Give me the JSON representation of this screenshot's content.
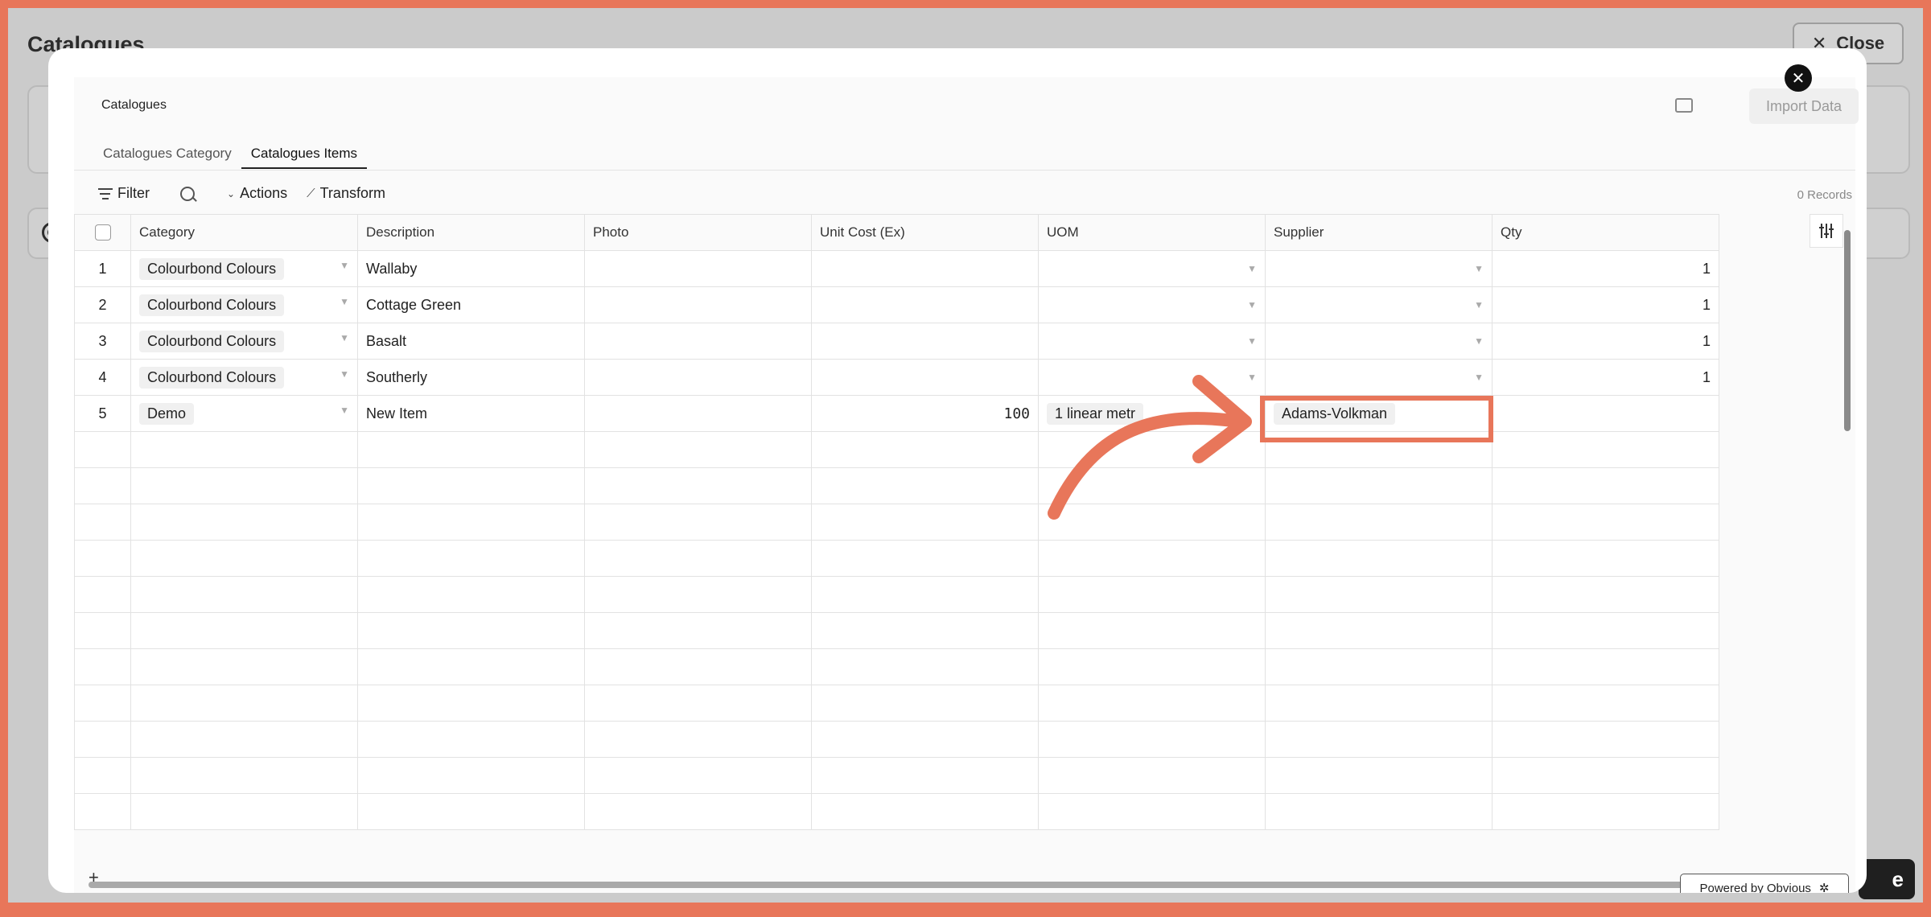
{
  "background": {
    "title": "Catalogues",
    "close_label": "Close",
    "dark_button_partial": "e"
  },
  "modal": {
    "title": "Catalogues",
    "import_label": "Import Data",
    "tabs": [
      "Catalogues Category",
      "Catalogues Items"
    ],
    "active_tab": "Catalogues Items",
    "toolbar": {
      "filter_label": "Filter",
      "actions_label": "Actions",
      "transform_label": "Transform"
    },
    "records_label": "0 Records",
    "columns": [
      "Category",
      "Description",
      "Photo",
      "Unit Cost (Ex)",
      "UOM",
      "Supplier",
      "Qty"
    ],
    "rows": [
      {
        "num": "1",
        "category": "Colourbond Colours",
        "description": "Wallaby",
        "photo": "",
        "unit_cost": "",
        "uom": "",
        "supplier": "",
        "qty": "1"
      },
      {
        "num": "2",
        "category": "Colourbond Colours",
        "description": "Cottage Green",
        "photo": "",
        "unit_cost": "",
        "uom": "",
        "supplier": "",
        "qty": "1"
      },
      {
        "num": "3",
        "category": "Colourbond Colours",
        "description": "Basalt",
        "photo": "",
        "unit_cost": "",
        "uom": "",
        "supplier": "",
        "qty": "1"
      },
      {
        "num": "4",
        "category": "Colourbond Colours",
        "description": "Southerly",
        "photo": "",
        "unit_cost": "",
        "uom": "",
        "supplier": "",
        "qty": "1"
      },
      {
        "num": "5",
        "category": "Demo",
        "description": "New Item",
        "photo": "",
        "unit_cost": "100",
        "uom": "1 linear metr",
        "supplier": "Adams-Volkman",
        "qty": ""
      }
    ],
    "add_row_label": "+",
    "powered_by": "Powered by Obvious"
  },
  "colors": {
    "accent": "#e8765a",
    "backdrop": "#cbcbcb"
  },
  "icons": [
    "close-icon",
    "truck-icon",
    "filter-icon",
    "search-icon",
    "chevron-down-icon",
    "wand-icon",
    "sliders-icon",
    "obvious-logo-icon",
    "arrow-annotation"
  ]
}
